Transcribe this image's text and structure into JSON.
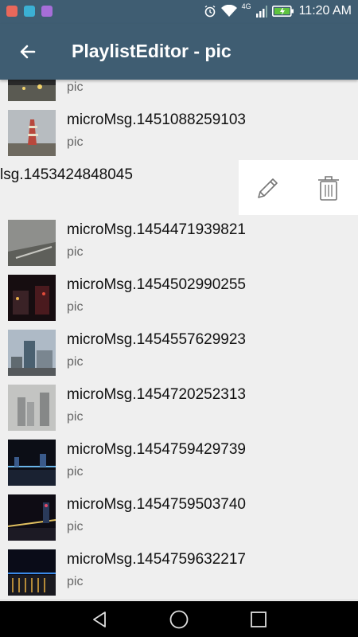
{
  "status_bar": {
    "time": "11:20 AM",
    "network": "4G",
    "app_icon_colors": [
      "#e8685b",
      "#3bb0d4",
      "#a66ed8"
    ]
  },
  "app_bar": {
    "title": "PlaylistEditor - pic"
  },
  "list": {
    "items": [
      {
        "title": "",
        "subtitle": "pic"
      },
      {
        "title": "microMsg.1451088259103",
        "subtitle": "pic"
      },
      {
        "title": "lsg.1453424848045",
        "subtitle": ""
      },
      {
        "title": "microMsg.1454471939821",
        "subtitle": "pic"
      },
      {
        "title": "microMsg.1454502990255",
        "subtitle": "pic"
      },
      {
        "title": "microMsg.1454557629923",
        "subtitle": "pic"
      },
      {
        "title": "microMsg.1454720252313",
        "subtitle": "pic"
      },
      {
        "title": "microMsg.1454759429739",
        "subtitle": "pic"
      },
      {
        "title": "microMsg.1454759503740",
        "subtitle": "pic"
      },
      {
        "title": "microMsg.1454759632217",
        "subtitle": "pic"
      }
    ]
  },
  "icons": {
    "back": "arrow-back-icon",
    "edit": "pencil-icon",
    "delete": "trash-icon",
    "nav_back": "triangle-back-icon",
    "nav_home": "circle-home-icon",
    "nav_recents": "square-recents-icon"
  }
}
